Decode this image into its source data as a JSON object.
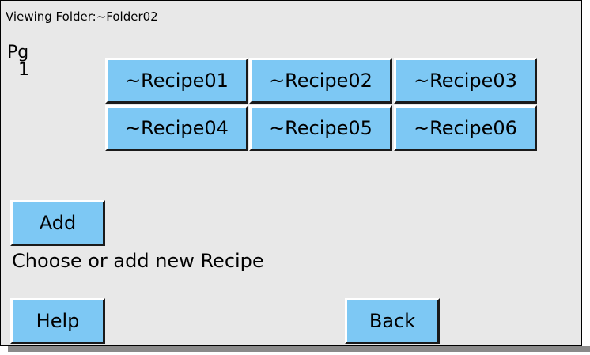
{
  "header": {
    "title": "Viewing Folder:~Folder02"
  },
  "page_indicator": {
    "label": "Pg",
    "number": "1"
  },
  "recipes": [
    {
      "label": "~Recipe01"
    },
    {
      "label": "~Recipe02"
    },
    {
      "label": "~Recipe03"
    },
    {
      "label": "~Recipe04"
    },
    {
      "label": "~Recipe05"
    },
    {
      "label": "~Recipe06"
    }
  ],
  "actions": {
    "add_label": "Add",
    "help_label": "Help",
    "back_label": "Back"
  },
  "status": {
    "message": "Choose or add new Recipe"
  },
  "colors": {
    "button_face": "#7dc8f4",
    "background": "#e8e8e8"
  }
}
